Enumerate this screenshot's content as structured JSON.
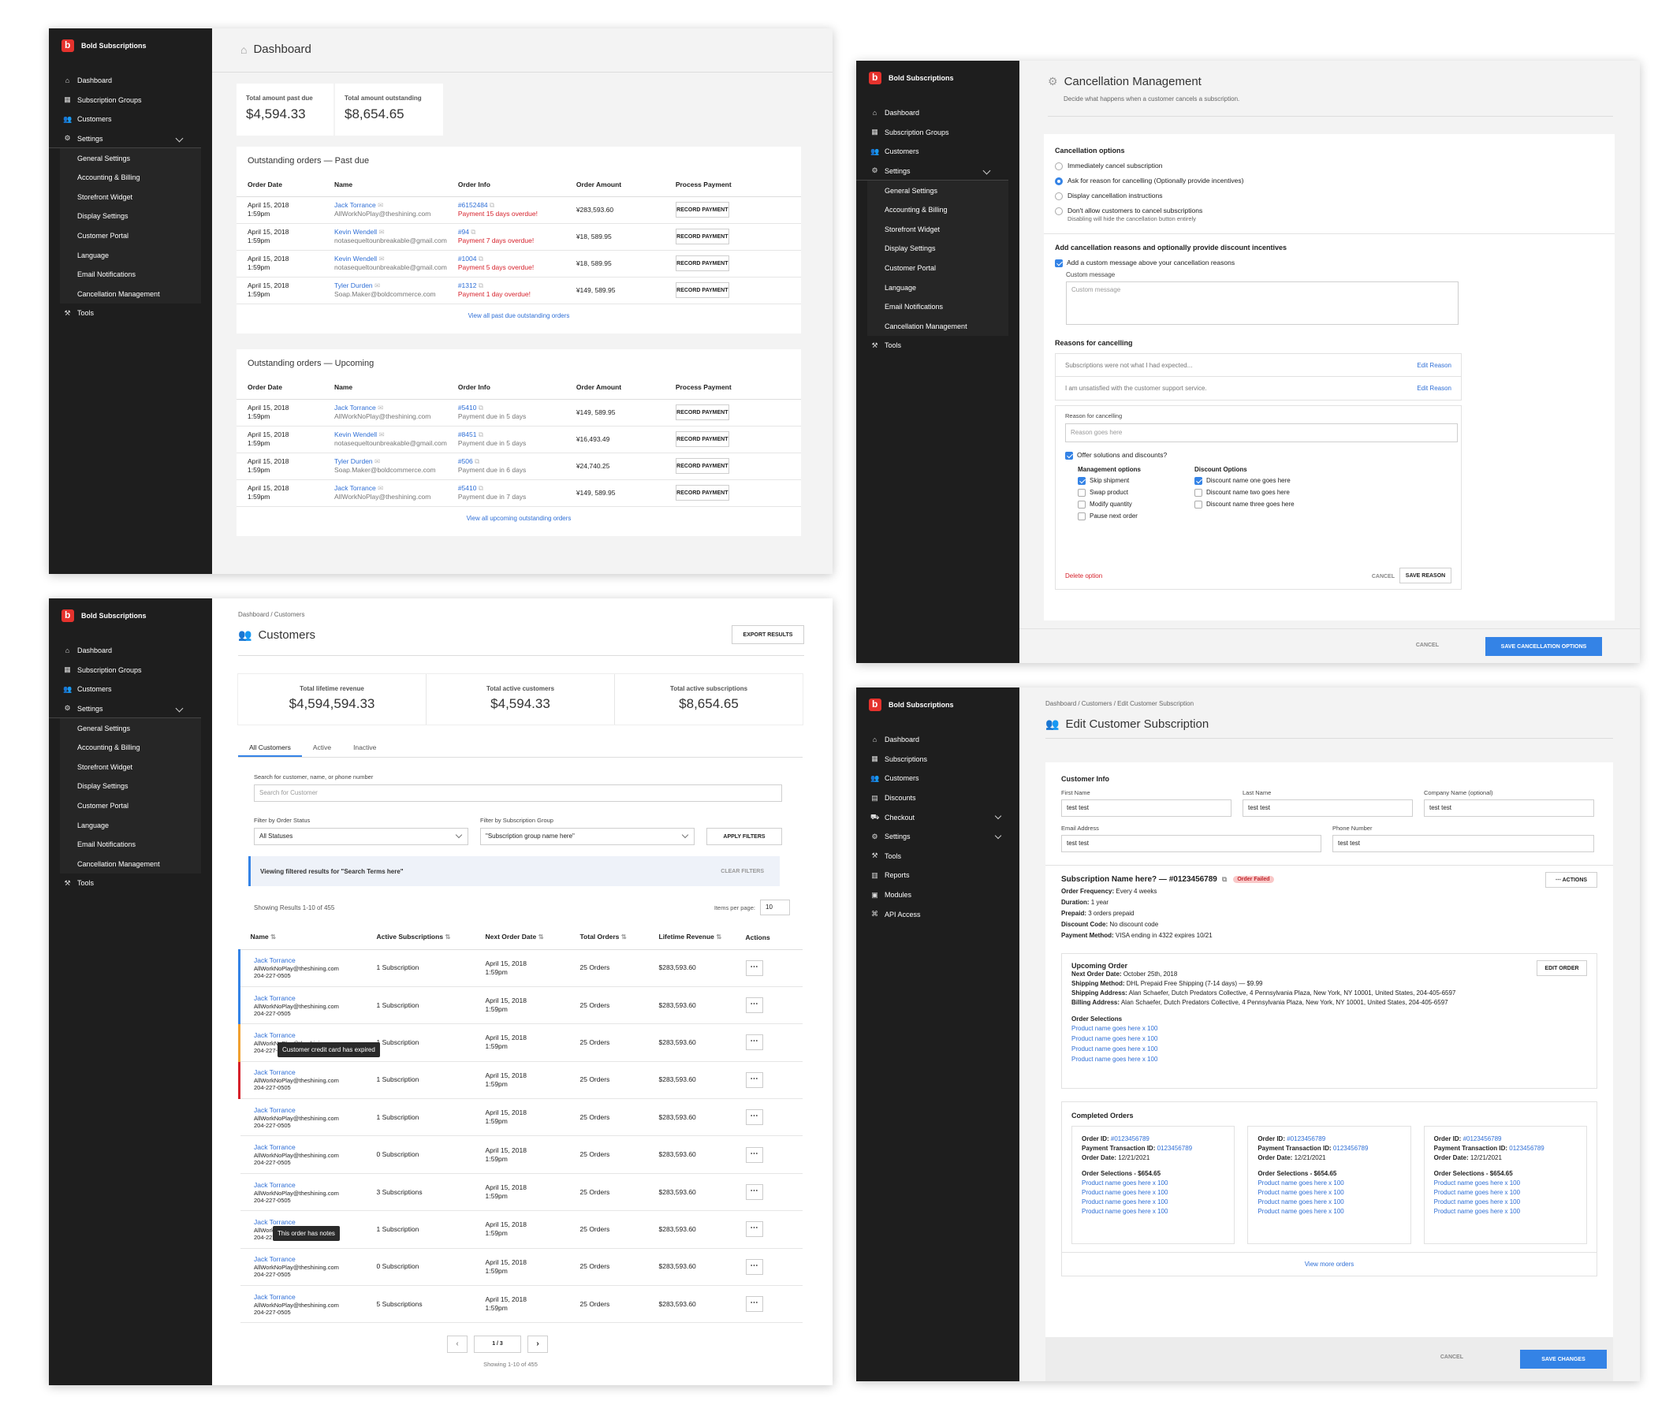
{
  "brand": "Bold Subscriptions",
  "nav_a": {
    "dashboard": "Dashboard",
    "groups": "Subscription Groups",
    "customers": "Customers",
    "settings": "Settings",
    "general": "General Settings",
    "accounting": "Accounting & Billing",
    "storefront": "Storefront Widget",
    "display": "Display Settings",
    "portal": "Customer Portal",
    "language": "Language",
    "email": "Email Notifications",
    "cancellation": "Cancellation Management",
    "tools": "Tools"
  },
  "nav_d": {
    "dashboard": "Dashboard",
    "subscriptions": "Subscriptions",
    "customers": "Customers",
    "discounts": "Discounts",
    "checkout": "Checkout",
    "settings": "Settings",
    "tools": "Tools",
    "reports": "Reports",
    "modules": "Modules",
    "api": "API Access"
  },
  "dashboard": {
    "title": "Dashboard",
    "stat1_label": "Total amount past due",
    "stat1_value": "$4,594.33",
    "stat2_label": "Total amount outstanding",
    "stat2_value": "$8,654.65",
    "past_title": "Outstanding orders — Past due",
    "upcoming_title": "Outstanding orders — Upcoming",
    "headers": [
      "Order Date",
      "Name",
      "Order Info",
      "Order Amount",
      "Process Payment"
    ],
    "record_btn": "RECORD PAYMENT",
    "past_rows": [
      {
        "date": "April 15, 2018",
        "time": "1:59pm",
        "name": "Jack Torrance",
        "email": "AllWorkNoPlay@theshining.com",
        "order": "#6152484",
        "status": "Payment 15 days overdue!",
        "amount": "¥283,593.60"
      },
      {
        "date": "April 15, 2018",
        "time": "1:59pm",
        "name": "Kevin Wendell",
        "email": "notasequeltounbreakable@gmail.com",
        "order": "#94",
        "status": "Payment 7 days overdue!",
        "amount": "¥18, 589.95"
      },
      {
        "date": "April 15, 2018",
        "time": "1:59pm",
        "name": "Kevin Wendell",
        "email": "notasequeltounbreakable@gmail.com",
        "order": "#1004",
        "status": "Payment 5 days overdue!",
        "amount": "¥18, 589.95"
      },
      {
        "date": "April 15, 2018",
        "time": "1:59pm",
        "name": "Tyler Durden",
        "email": "Soap.Maker@boldcommerce.com",
        "order": "#1312",
        "status": "Payment 1 day overdue!",
        "amount": "¥149, 589.95"
      }
    ],
    "past_link": "View all past due outstanding orders",
    "up_rows": [
      {
        "date": "April 15, 2018",
        "time": "1:59pm",
        "name": "Jack Torrance",
        "email": "AllWorkNoPlay@theshining.com",
        "order": "#5410",
        "status": "Payment due in 5 days",
        "amount": "¥149, 589.95"
      },
      {
        "date": "April 15, 2018",
        "time": "1:59pm",
        "name": "Kevin Wendell",
        "email": "notasequeltounbreakable@gmail.com",
        "order": "#8451",
        "status": "Payment due in 5 days",
        "amount": "¥16,493.49"
      },
      {
        "date": "April 15, 2018",
        "time": "1:59pm",
        "name": "Tyler Durden",
        "email": "Soap.Maker@boldcommerce.com",
        "order": "#506",
        "status": "Payment due in 6 days",
        "amount": "¥24,740.25"
      },
      {
        "date": "April 15, 2018",
        "time": "1:59pm",
        "name": "Jack Torrance",
        "email": "AllWorkNoPlay@theshining.com",
        "order": "#5410",
        "status": "Payment due in 7 days",
        "amount": "¥149, 589.95"
      }
    ],
    "up_link": "View all upcoming outstanding orders"
  },
  "cancel": {
    "title": "Cancellation Management",
    "subtitle": "Decide what happens when a customer cancels a subscription.",
    "options_title": "Cancellation options",
    "opt1": "Immediately cancel subscription",
    "opt2": "Ask for reason for cancelling (Optionally provide incentives)",
    "opt3": "Display cancellation instructions",
    "opt4": "Don't allow customers to cancel subscriptions",
    "opt4_note": "Disabling will hide the cancellation button entirely",
    "reasons_section": "Add cancellation reasons and optionally provide discount incentives",
    "custom_check": "Add a custom message above your cancellation reasons",
    "custom_label": "Custom message",
    "custom_placeholder": "Custom message",
    "reasons_title": "Reasons for cancelling",
    "reason1": "Subscriptions were not what I had expected...",
    "reason2": "I am unsatisfied with the customer support service.",
    "edit_reason": "Edit Reason",
    "reason_label": "Reason for cancelling",
    "reason_placeholder": "Reason goes here",
    "offer": "Offer solutions and discounts?",
    "mgmt_title": "Management options",
    "mgmt": [
      "Skip shipment",
      "Swap product",
      "Modify quantity",
      "Pause next order"
    ],
    "disc_title": "Discount Options",
    "disc": [
      "Discount name one goes here",
      "Discount name two goes here",
      "Discount name three goes here"
    ],
    "delete": "Delete option",
    "cancel_btn": "CANCEL",
    "save_reason": "SAVE REASON",
    "footer_cancel": "CANCEL",
    "footer_save": "SAVE CANCELLATION OPTIONS"
  },
  "customers": {
    "breadcrumb": "Dashboard / Customers",
    "title": "Customers",
    "export": "EXPORT RESULTS",
    "s1_label": "Total lifetime revenue",
    "s1_value": "$4,594,594.33",
    "s2_label": "Total active customers",
    "s2_value": "$4,594.33",
    "s3_label": "Total active subscriptions",
    "s3_value": "$8,654.65",
    "tabs": [
      "All Customers",
      "Active",
      "Inactive"
    ],
    "search_label": "Search for customer, name, or phone number",
    "search_placeholder": "Search for Customer",
    "status_label": "Filter by Order Status",
    "status_value": "All Statuses",
    "group_label": "Filter by Subscription Group",
    "group_value": "\"Subscription group name here\"",
    "apply": "APPLY FILTERS",
    "banner": "Viewing filtered results for \"Search Terms here\"",
    "clear": "CLEAR FILTERS",
    "showing": "Showing Results 1-10 of 455",
    "per_page_label": "Items per page:",
    "per_page": "10",
    "headers": [
      "Name",
      "Active Subscriptions",
      "Next Order Date",
      "Total Orders",
      "Lifetime Revenue",
      "Actions"
    ],
    "rows": [
      {
        "name": "Jack Torrance",
        "email": "AllWorkNoPlay@theshining.com",
        "phone": "204-227-0505",
        "subs": "1 Subscription",
        "date": "April 15, 2018",
        "time": "1:59pm",
        "orders": "25 Orders",
        "rev": "$283,593.60",
        "accent": "#3483e6"
      },
      {
        "name": "Jack Torrance",
        "email": "AllWorkNoPlay@theshining.com",
        "phone": "204-227-0505",
        "subs": "1 Subscription",
        "date": "April 15, 2018",
        "time": "1:59pm",
        "orders": "25 Orders",
        "rev": "$283,593.60",
        "accent": "#3483e6"
      },
      {
        "name": "Jack Torrance",
        "email": "AllWorkNoPlay@theshining.com",
        "phone": "204-227-0505",
        "subs": "1 Subscription",
        "date": "April 15, 2018",
        "time": "1:59pm",
        "orders": "25 Orders",
        "rev": "$283,593.60",
        "accent": "#f0a030"
      },
      {
        "name": "Jack Torrance",
        "email": "AllWorkNoPlay@theshining.com",
        "phone": "204-227-0505",
        "subs": "1 Subscription",
        "date": "April 15, 2018",
        "time": "1:59pm",
        "orders": "25 Orders",
        "rev": "$283,593.60",
        "accent": "#d6212b"
      },
      {
        "name": "Jack Torrance",
        "email": "AllWorkNoPlay@theshining.com",
        "phone": "204-227-0505",
        "subs": "1 Subscription",
        "date": "April 15, 2018",
        "time": "1:59pm",
        "orders": "25 Orders",
        "rev": "$283,593.60",
        "accent": ""
      },
      {
        "name": "Jack Torrance",
        "email": "AllWorkNoPlay@theshining.com",
        "phone": "204-227-0505",
        "subs": "0 Subscription",
        "date": "April 15, 2018",
        "time": "1:59pm",
        "orders": "25 Orders",
        "rev": "$283,593.60",
        "accent": ""
      },
      {
        "name": "Jack Torrance",
        "email": "AllWorkNoPlay@theshining.com",
        "phone": "204-227-0505",
        "subs": "3 Subscriptions",
        "date": "April 15, 2018",
        "time": "1:59pm",
        "orders": "25 Orders",
        "rev": "$283,593.60",
        "accent": ""
      },
      {
        "name": "Jack Torrance",
        "email": "AllWorkNoPlay@theshining.com",
        "phone": "204-227-0505",
        "subs": "1 Subscription",
        "date": "April 15, 2018",
        "time": "1:59pm",
        "orders": "25 Orders",
        "rev": "$283,593.60",
        "accent": ""
      },
      {
        "name": "Jack Torrance",
        "email": "AllWorkNoPlay@theshining.com",
        "phone": "204-227-0505",
        "subs": "0 Subscription",
        "date": "April 15, 2018",
        "time": "1:59pm",
        "orders": "25 Orders",
        "rev": "$283,593.60",
        "accent": ""
      },
      {
        "name": "Jack Torrance",
        "email": "AllWorkNoPlay@theshining.com",
        "phone": "204-227-0505",
        "subs": "5 Subscriptions",
        "date": "April 15, 2018",
        "time": "1:59pm",
        "orders": "25 Orders",
        "rev": "$283,593.60",
        "accent": ""
      }
    ],
    "tip1": "Customer credit card has expired",
    "tip2": "This order has notes",
    "page": "1 / 3",
    "footer": "Showing 1-10 of 455"
  },
  "edit": {
    "breadcrumb": "Dashboard / Customers / Edit Customer Subscription",
    "title": "Edit Customer Subscription",
    "info_title": "Customer Info",
    "first_label": "First Name",
    "first": "test test",
    "last_label": "Last Name",
    "last": "test test",
    "company_label": "Company Name (optional)",
    "company": "test test",
    "email_label": "Email Address",
    "email": "test test",
    "phone_label": "Phone Number",
    "phone": "test test",
    "sub_name": "Subscription Name here? — #0123456789",
    "badge": "Order Failed",
    "actions": "ACTIONS",
    "freq_k": "Order Frequency:",
    "freq_v": "Every 4 weeks",
    "dur_k": "Duration:",
    "dur_v": "1 year",
    "pre_k": "Prepaid:",
    "pre_v": "3 orders prepaid",
    "disc_k": "Discount Code:",
    "disc_v": "No discount code",
    "pay_k": "Payment Method:",
    "pay_v": "VISA ending in 4322 expires 10/21",
    "up_title": "Upcoming Order",
    "edit_order": "EDIT ORDER",
    "next_k": "Next Order Date:",
    "next_v": "October 25th, 2018",
    "ship_k": "Shipping Method:",
    "ship_v": "DHL Prepaid Free Shipping (7-14 days) — $9.99",
    "saddr_k": "Shipping Address:",
    "saddr_v": "Alan Schaefer, Dutch Predators Collective, 4 Pennsylvania Plaza, New York, NY 10001, United States, 204-405-6597",
    "baddr_k": "Billing Address:",
    "baddr_v": "Alan Schaefer, Dutch Predators Collective, 4 Pennsylvania Plaza, New York, NY 10001, United States, 204-405-6597",
    "sel_title": "Order Selections",
    "product": "Product name goes here x 100",
    "completed_title": "Completed Orders",
    "oid_k": "Order ID:",
    "oid_v": "#0123456789",
    "ptid_k": "Payment Transaction ID:",
    "ptid_v": "0123456789",
    "odate_k": "Order Date:",
    "odate_v": "12/21/2021",
    "sel_total": "Order Selections - $654.65",
    "view_more": "View more orders",
    "cancel": "CANCEL",
    "save": "SAVE CHANGES"
  }
}
